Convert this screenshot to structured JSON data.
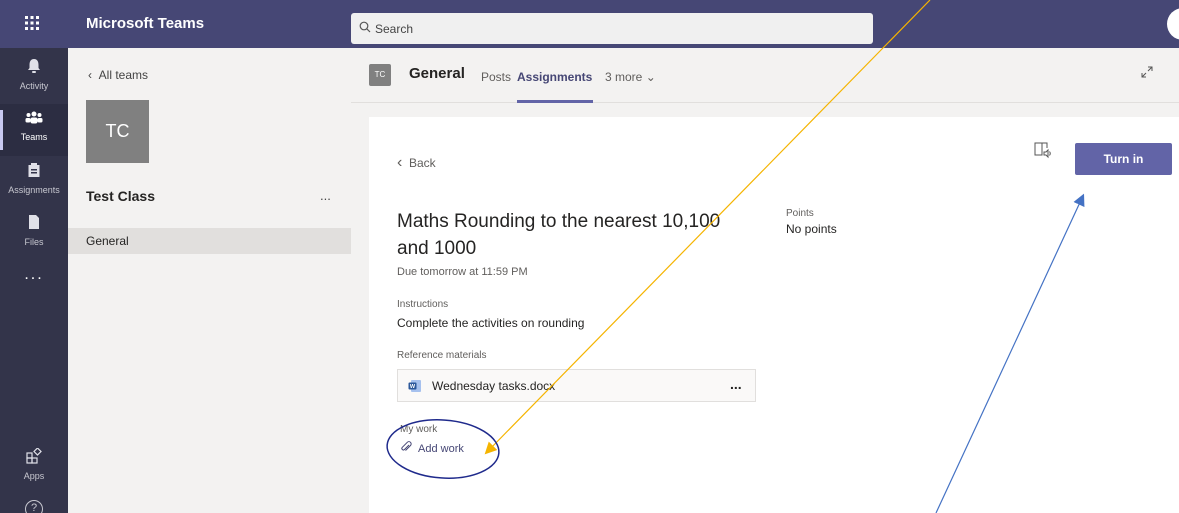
{
  "topbar": {
    "app_title": "Microsoft Teams",
    "search_placeholder": "Search",
    "apps_icon": "waffle-grid-icon"
  },
  "rail": {
    "items": [
      {
        "label": "Activity",
        "icon": "bell-icon"
      },
      {
        "label": "Teams",
        "icon": "teams-icon"
      },
      {
        "label": "Assignments",
        "icon": "assignments-icon"
      },
      {
        "label": "Files",
        "icon": "file-icon"
      }
    ],
    "more": "...",
    "apps_label": "Apps",
    "help_icon": "help-icon"
  },
  "team_panel": {
    "back_label": "All teams",
    "team_initials": "TC",
    "team_name": "Test Class",
    "team_menu": "...",
    "channels": [
      "General"
    ]
  },
  "channel_header": {
    "avatar": "TC",
    "title": "General",
    "tabs": [
      "Posts",
      "Assignments",
      "3 more"
    ],
    "active_tab": "Assignments"
  },
  "assignment": {
    "back_label": "Back",
    "turn_in_label": "Turn in",
    "title": "Maths Rounding to the nearest 10,100 and 1000",
    "due": "Due tomorrow at 11:59 PM",
    "points_label": "Points",
    "points_value": "No points",
    "instructions_label": "Instructions",
    "instructions_text": "Complete the activities on rounding",
    "reference_label": "Reference materials",
    "reference_file": "Wednesday tasks.docx",
    "reference_menu": "...",
    "my_work_label": "My work",
    "add_work_label": "Add work"
  },
  "colors": {
    "topbar": "#464775",
    "rail": "#33344a",
    "accent": "#6264a7",
    "annotation_arrow_orange": "#f5b400",
    "annotation_arrow_blue": "#4472c4",
    "annotation_circle": "#1f2a8c"
  }
}
